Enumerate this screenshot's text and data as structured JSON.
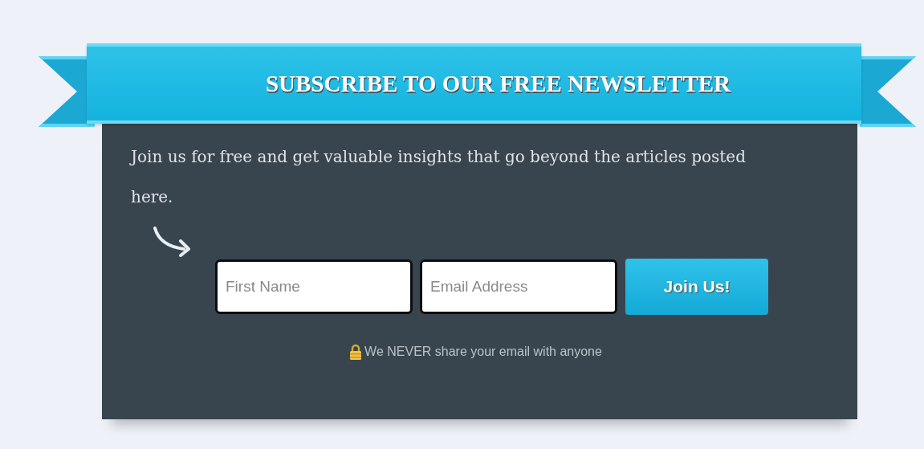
{
  "banner": {
    "title": "SUBSCRIBE TO OUR FREE NEWSLETTER"
  },
  "intro": "Join us for free and get valuable insights that go beyond the articles posted here.",
  "fields": [
    {
      "placeholder": "First Name"
    },
    {
      "placeholder": "Email Address"
    }
  ],
  "submit": "Join Us!",
  "privacy_note": "We NEVER share your email with anyone"
}
